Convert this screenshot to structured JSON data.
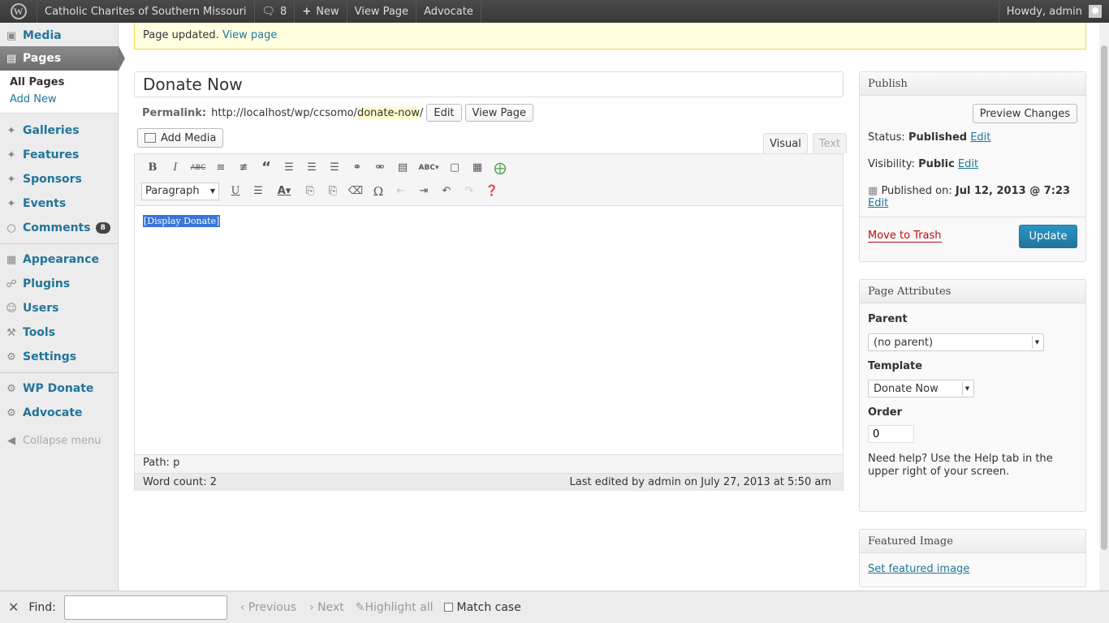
{
  "adminbar": {
    "site_name": "Catholic Charites of Southern Missouri",
    "comments_count": "8",
    "new_label": "New",
    "view_page": "View Page",
    "advocate": "Advocate",
    "howdy": "Howdy, admin"
  },
  "sidebar": {
    "media": "Media",
    "pages": "Pages",
    "all_pages": "All Pages",
    "add_new": "Add New",
    "galleries": "Galleries",
    "features": "Features",
    "sponsors": "Sponsors",
    "events": "Events",
    "comments": "Comments",
    "comments_badge": "8",
    "appearance": "Appearance",
    "plugins": "Plugins",
    "users": "Users",
    "tools": "Tools",
    "settings": "Settings",
    "wp_donate": "WP Donate",
    "advocate": "Advocate",
    "collapse": "Collapse menu"
  },
  "notice": {
    "text": "Page updated.",
    "link": "View page"
  },
  "editor": {
    "title": "Donate Now",
    "permalink_label": "Permalink:",
    "permalink_base": "http://localhost/wp/ccsomo/",
    "permalink_slug": "donate-now",
    "permalink_trail": "/",
    "edit_btn": "Edit",
    "view_page_btn": "View Page",
    "add_media": "Add Media",
    "tab_visual": "Visual",
    "tab_text": "Text",
    "format": "Paragraph",
    "content": "[Display Donate]",
    "path": "Path: p",
    "word_count": "Word count: 2",
    "last_edited": "Last edited by admin on July 27, 2013 at 5:50 am"
  },
  "publish": {
    "heading": "Publish",
    "preview": "Preview Changes",
    "status_label": "Status:",
    "status_value": "Published",
    "visibility_label": "Visibility:",
    "visibility_value": "Public",
    "published_label": "Published on:",
    "published_value": "Jul 12, 2013 @ 7:23",
    "edit": "Edit",
    "trash": "Move to Trash",
    "update": "Update"
  },
  "attributes": {
    "heading": "Page Attributes",
    "parent_label": "Parent",
    "parent_value": "(no parent)",
    "template_label": "Template",
    "template_value": "Donate Now",
    "order_label": "Order",
    "order_value": "0",
    "help": "Need help? Use the Help tab in the upper right of your screen."
  },
  "featured": {
    "heading": "Featured Image",
    "link": "Set featured image"
  },
  "findbar": {
    "find_label": "Find:",
    "previous": "Previous",
    "next": "Next",
    "highlight": "Highlight all",
    "match_case": "Match case"
  }
}
